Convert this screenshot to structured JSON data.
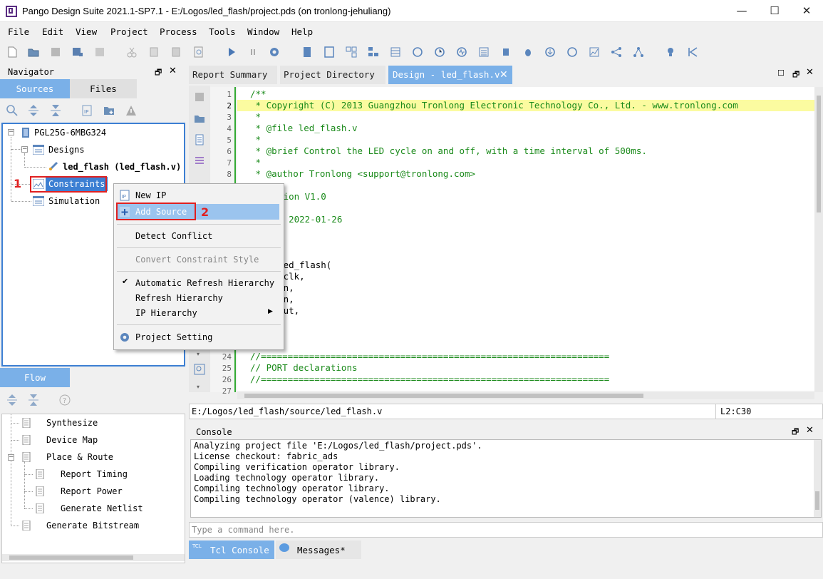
{
  "window": {
    "title": "Pango Design Suite 2021.1-SP7.1 - E:/Logos/led_flash/project.pds (on tronlong-jehuliang)",
    "minimize": "—",
    "maximize": "☐",
    "close": "✕"
  },
  "menubar": [
    "File",
    "Edit",
    "View",
    "Project",
    "Process",
    "Tools",
    "Window",
    "Help"
  ],
  "navigator": {
    "title": "Navigator",
    "tabs": [
      "Sources",
      "Files"
    ],
    "active_tab": "Sources",
    "tree": {
      "device": "PGL25G-6MBG324",
      "designs": "Designs",
      "design_file": "led_flash (led_flash.v)",
      "constraints": "Constraints",
      "simulation": "Simulation"
    }
  },
  "annotations": {
    "step1": "1",
    "step2": "2"
  },
  "context_menu": {
    "items": [
      {
        "label": "New IP",
        "enabled": true
      },
      {
        "label": "Add Source",
        "enabled": true,
        "highlighted": true
      },
      {
        "label": "Detect Conflict",
        "enabled": true
      },
      {
        "label": "Convert Constraint Style",
        "enabled": false
      },
      {
        "label": "Automatic Refresh Hierarchy",
        "enabled": true,
        "checked": true
      },
      {
        "label": "Refresh Hierarchy",
        "enabled": true
      },
      {
        "label": "IP Hierarchy",
        "enabled": true,
        "submenu": true
      },
      {
        "label": "Project Setting",
        "enabled": true
      }
    ]
  },
  "flow": {
    "title": "Flow",
    "items": [
      "Synthesize",
      "Device Map",
      "Place & Route",
      "Report Timing",
      "Report Power",
      "Generate Netlist",
      "Generate Bitstream"
    ]
  },
  "editor": {
    "tabs": [
      "Report Summary",
      "Project Directory",
      "Design - led_flash.v"
    ],
    "active_tab": "Design - led_flash.v",
    "line_numbers": [
      "1",
      "2",
      "3",
      "4",
      "5",
      "6",
      "7",
      "8",
      "",
      "",
      "",
      "",
      "",
      "",
      "",
      "",
      "",
      "",
      "",
      "",
      "",
      "",
      "",
      "24",
      "25",
      "26",
      "27"
    ],
    "code_lines": [
      "/**",
      " * Copyright (C) 2013 Guangzhou Tronlong Electronic Technology Co., Ltd. - www.tronlong.com",
      " *",
      " * @file led_flash.v",
      " *",
      " * @brief Control the LED cycle on and off, with a time interval of 500ms.",
      " *",
      " * @author Tronlong <support@tronlong.com>",
      "ersion V1.0",
      "ate 2022-01-26",
      "e led_flash(",
      "ys_clk,",
      "st_n,",
      "s_in,",
      "s_out,",
      "ed",
      "//=================================================================",
      "// PORT declarations",
      "//================================================================="
    ],
    "file_path": "E:/Logos/led_flash/source/led_flash.v",
    "cursor": "L2:C30"
  },
  "console": {
    "title": "Console",
    "lines": [
      "Analyzing project file 'E:/Logos/led_flash/project.pds'.",
      "License checkout: fabric_ads",
      "Compiling verification operator library.",
      "Loading technology operator library.",
      "Compiling technology operator library.",
      "Compiling technology operator (valence) library."
    ],
    "command_placeholder": "Type a command here.",
    "tabs": [
      "Tcl Console",
      "Messages*"
    ],
    "tcl_badge": "TCL"
  },
  "colors": {
    "accent": "#3c7fd3",
    "tab_active": "#7ab0e8",
    "highlight_line": "#fbfba0",
    "annotation": "#e02020",
    "comment": "#1a8a1a"
  }
}
